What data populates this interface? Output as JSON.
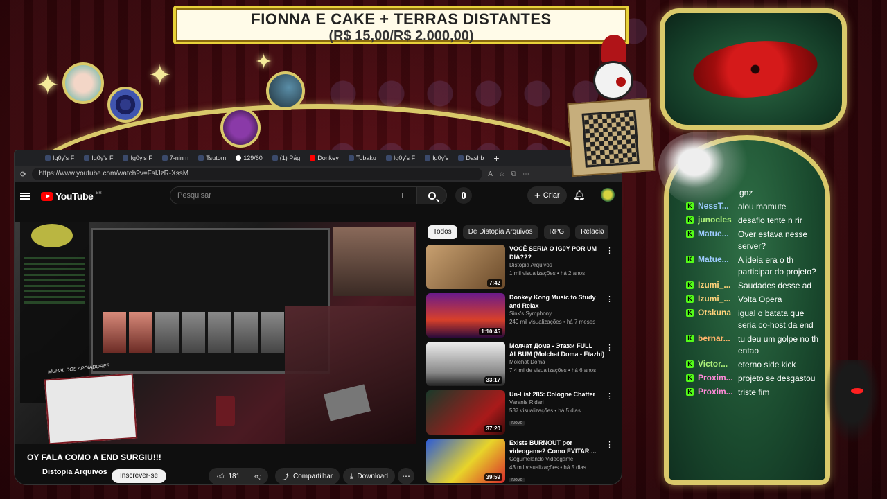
{
  "goal": {
    "title": "FIONNA E CAKE + TERRAS DISTANTES",
    "progress": "(R$ 15,00/R$ 2.000,00)"
  },
  "browser": {
    "tabs": [
      {
        "label": "Ig0y's F",
        "icon": "fav-blue"
      },
      {
        "label": "Ig0y's F",
        "icon": "fav-blue"
      },
      {
        "label": "Ig0y's F",
        "icon": "fav-blue"
      },
      {
        "label": "7-nin n",
        "icon": "fav-blue"
      },
      {
        "label": "Tsutom",
        "icon": "fav-blue"
      },
      {
        "label": "129/60",
        "icon": "google"
      },
      {
        "label": "(1) Pág",
        "icon": "x"
      },
      {
        "label": "Donkey",
        "icon": "youtube"
      },
      {
        "label": "Tobaku",
        "icon": "fav-blue"
      },
      {
        "label": "Ig0y's F",
        "icon": "fav-blue"
      },
      {
        "label": "Ig0y's",
        "icon": "fav-blue"
      },
      {
        "label": "Dashb",
        "icon": "fav-blue"
      }
    ],
    "url": "https://www.youtube.com/watch?v=FsIJzR-XssM"
  },
  "youtube": {
    "logo": "YouTube",
    "region": "BR",
    "search_placeholder": "Pesquisar",
    "create_label": "Criar",
    "video": {
      "title": "OY FALA COMO A END SURGIU!!!",
      "channel": "Distopia Arquivos",
      "subscribe_label": "Inscrever-se",
      "likes": "181",
      "share_label": "Compartilhar",
      "download_label": "Download",
      "mural_label": "MURAL DOS APOIADORES"
    },
    "chips": [
      "Todos",
      "De Distopia Arquivos",
      "RPG",
      "Relacio"
    ],
    "recommended": [
      {
        "title": "VOCÊ SERIA O IG0Y POR UM DIA???",
        "channel": "Distopia Arquivos",
        "meta": "1 mil visualizações • há 2 anos",
        "duration": "7:42",
        "badge": "",
        "thumb": "linear-gradient(135deg,#c8a070,#6a4a2a)"
      },
      {
        "title": "Donkey Kong Music to Study and Relax",
        "channel": "Sink's Symphony",
        "meta": "249 mil visualizações • há 7 meses",
        "duration": "1:10:45",
        "badge": "",
        "thumb": "linear-gradient(180deg,#6a1a8a,#d8402a 60%,#2a0a3a)"
      },
      {
        "title": "Молчат Дома - Этажи FULL ALBUM (Molchat Doma - Etazhi)",
        "channel": "Molchat Doma",
        "meta": "7,4 mi de visualizações • há 6 anos",
        "duration": "33:17",
        "badge": "",
        "thumb": "linear-gradient(180deg,#eeeeee,#888 70%,#222)"
      },
      {
        "title": "Un-List 285: Cologne Chatter",
        "channel": "Varanis Ridari",
        "meta": "537 visualizações • há 5 dias",
        "duration": "37:20",
        "badge": "Novo",
        "thumb": "linear-gradient(135deg,#1a3a2a,#aa1a1a 70%,#3a0a0a)"
      },
      {
        "title": "Existe BURNOUT por videogame? Como EVITAR ...",
        "channel": "Cogumelando Videogame",
        "meta": "43 mil visualizações • há 5 dias",
        "duration": "39:59",
        "badge": "Novo",
        "thumb": "linear-gradient(135deg,#2a5ad8,#e8d42a 55%,#d82a2a)"
      }
    ]
  },
  "chat": {
    "messages": [
      {
        "user": "",
        "text": "gnz",
        "color": "#ffffff"
      },
      {
        "user": "NessT...",
        "text": "alou mamute",
        "color": "#9ecbff"
      },
      {
        "user": "junocles",
        "text": "desafio tente n rir",
        "color": "#aef27a"
      },
      {
        "user": "Matue...",
        "text": "Over estava nesse server?",
        "color": "#9ecbff"
      },
      {
        "user": "Matue...",
        "text": "A ideia era o th participar do projeto?",
        "color": "#9ecbff"
      },
      {
        "user": "Izumi_...",
        "text": "Saudades desse ad",
        "color": "#ffd27a"
      },
      {
        "user": "Izumi_...",
        "text": "Volta Opera",
        "color": "#ffd27a"
      },
      {
        "user": "Otskuna",
        "text": "igual o batata que seria co-host da end",
        "color": "#ffd27a"
      },
      {
        "user": "bernar...",
        "text": "tu deu um golpe no th entao",
        "color": "#ffb36a"
      },
      {
        "user": "Victor...",
        "text": "eterno side kick",
        "color": "#aef27a"
      },
      {
        "user": "Proxim...",
        "text": "projeto se desgastou",
        "color": "#ff8ad8"
      },
      {
        "user": "Proxim...",
        "text": "triste fim",
        "color": "#ff8ad8"
      }
    ]
  }
}
